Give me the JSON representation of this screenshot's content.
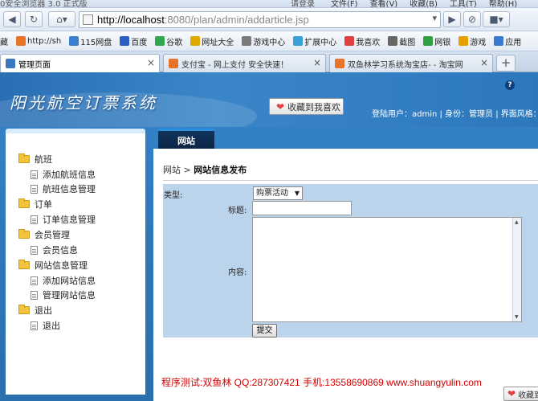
{
  "browser": {
    "title_left": "0安全浏览器 3.0 正式版",
    "title_mid": "请登录",
    "menus": [
      "文件(F)",
      "查看(V)",
      "收藏(B)",
      "工具(T)",
      "帮助(H)"
    ],
    "url_host": "http://localhost",
    "url_rest": ":8080/plan/admin/addarticle.jsp",
    "favorites": [
      {
        "label": "藏",
        "color": "#e6b800"
      },
      {
        "label": "http://sh",
        "color": "#e8742a"
      },
      {
        "label": "115网盘",
        "color": "#3b7fd0"
      },
      {
        "label": "百度",
        "color": "#2d5ec6"
      },
      {
        "label": "谷歌",
        "color": "#2fa84f"
      },
      {
        "label": "网址大全",
        "color": "#e0a800"
      },
      {
        "label": "游戏中心",
        "color": "#7a7a7a"
      },
      {
        "label": "扩展中心",
        "color": "#3aa0d8"
      },
      {
        "label": "我喜欢",
        "color": "#e04040"
      },
      {
        "label": "截图",
        "color": "#666666"
      },
      {
        "label": "网银",
        "color": "#30a040"
      },
      {
        "label": "游戏",
        "color": "#e8a000"
      },
      {
        "label": "应用",
        "color": "#3a7ad0"
      }
    ],
    "tabs": [
      {
        "label": "管理页面",
        "active": true,
        "color": "#3a78c0"
      },
      {
        "label": "支付宝 - 网上支付 安全快速！",
        "active": false,
        "color": "#e8742a"
      },
      {
        "label": "双鱼林学习系统淘宝店- - 淘宝网",
        "active": false,
        "color": "#e8742a"
      }
    ]
  },
  "header": {
    "logo": "阳光航空订票系统",
    "collect_label": "收藏到我喜欢",
    "help": "?",
    "user_info": "登陆用户：admin | 身份：管理员 | 界面风格："
  },
  "sidebar": {
    "groups": [
      {
        "label": "航班",
        "items": [
          "添加航班信息",
          "航班信息管理"
        ]
      },
      {
        "label": "订单",
        "items": [
          "订单信息管理"
        ]
      },
      {
        "label": "会员管理",
        "items": [
          "会员信息"
        ]
      },
      {
        "label": "网站信息管理",
        "items": [
          "添加网站信息",
          "管理网站信息"
        ]
      },
      {
        "label": "退出",
        "items": [
          "退出"
        ]
      }
    ]
  },
  "content": {
    "tab_label": "网站",
    "breadcrumb_root": "网站",
    "breadcrumb_sep": ">",
    "breadcrumb_page": "网站信息发布",
    "form": {
      "type_label": "类型:",
      "type_value": "购票活动",
      "title_label": "标题:",
      "title_value": "",
      "content_label": "内容:",
      "content_value": "",
      "submit_label": "提交"
    },
    "footer_note": "程序测试:双鱼林 QQ:287307421 手机:13558690869 www.shuangyulin.com"
  },
  "corner_button": {
    "label": "收藏到我喜欢"
  }
}
